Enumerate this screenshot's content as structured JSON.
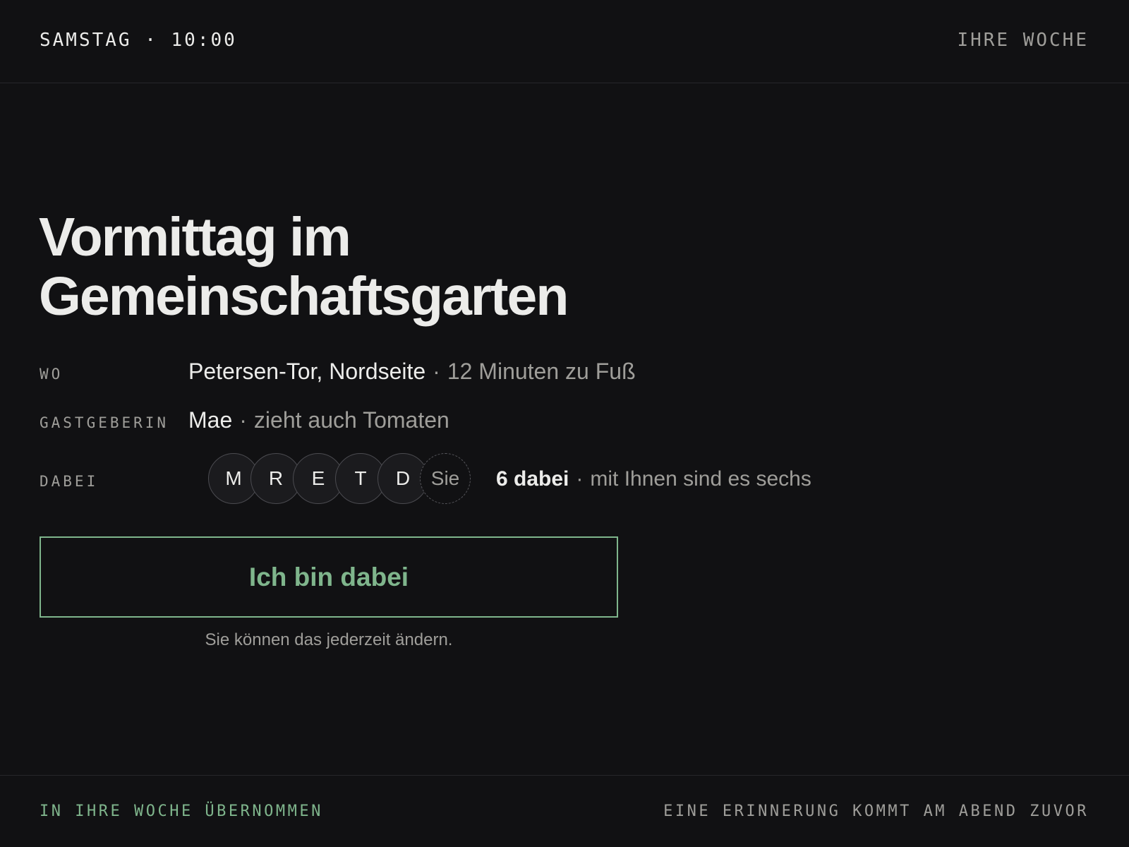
{
  "header": {
    "when": "SAMSTAG · 10:00",
    "week_link": "IHRE WOCHE"
  },
  "event": {
    "title_line1": "Vormittag im",
    "title_line2": "Gemeinschaftsgarten"
  },
  "details": {
    "where": {
      "label": "WO",
      "place": "Petersen-Tor, Nordseite",
      "separator": "·",
      "distance": "12 Minuten zu Fuß"
    },
    "host": {
      "label": "GASTGEBERIN",
      "name": "Mae",
      "separator": "·",
      "note": "zieht auch Tomaten"
    },
    "attending": {
      "label": "DABEI",
      "avatars": [
        "M",
        "R",
        "E",
        "T",
        "D"
      ],
      "you": "Sie",
      "count": "6 dabei",
      "separator": "·",
      "note": "mit Ihnen sind es sechs"
    }
  },
  "cta": {
    "join_label": "Ich bin dabei",
    "hint": "Sie können das jederzeit ändern."
  },
  "footer": {
    "status": "IN IHRE WOCHE ÜBERNOMMEN",
    "reminder": "EINE ERINNERUNG KOMMT AM ABEND ZUVOR"
  },
  "colors": {
    "background": "#111113",
    "text": "#ececea",
    "muted": "#9f9e9a",
    "accent": "#7fb58c"
  }
}
